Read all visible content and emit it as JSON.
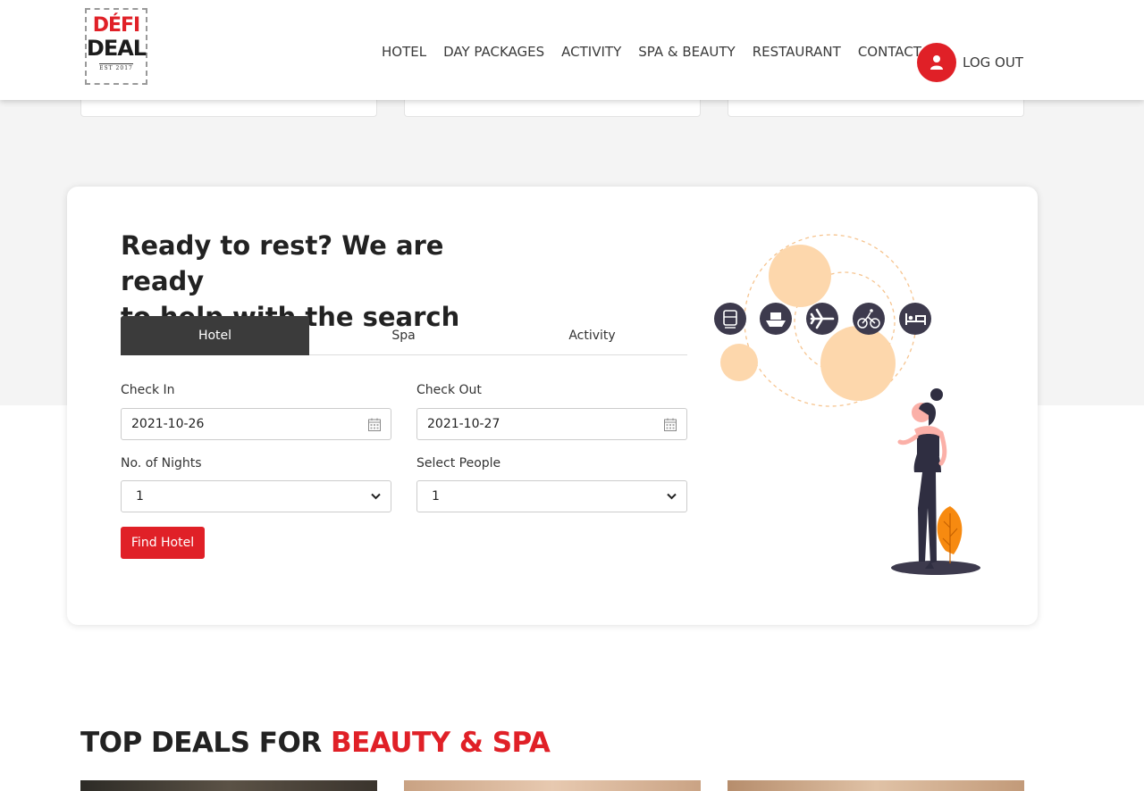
{
  "brand": {
    "logo_line1": "DÉFI",
    "logo_line2": "DEAL",
    "logo_est": "EST 2017"
  },
  "nav": {
    "items": [
      "HOTEL",
      "DAY PACKAGES",
      "ACTIVITY",
      "SPA & BEAUTY",
      "RESTAURANT",
      "CONTACT"
    ],
    "logout_label": "LOG OUT",
    "user_icon": "user-icon"
  },
  "search": {
    "title_line1": "Ready to rest? We are ready",
    "title_line2": "to help with the search",
    "tabs": [
      {
        "label": "Hotel",
        "active": true
      },
      {
        "label": "Spa",
        "active": false
      },
      {
        "label": "Activity",
        "active": false
      }
    ],
    "check_in": {
      "label": "Check In",
      "value": "2021-10-26",
      "icon": "calendar-icon"
    },
    "check_out": {
      "label": "Check Out",
      "value": "2021-10-27",
      "icon": "calendar-icon"
    },
    "nights": {
      "label": "No. of Nights",
      "value": "1",
      "icon": "chevron-down-icon"
    },
    "people": {
      "label": "Select People",
      "value": "1",
      "icon": "chevron-down-icon"
    },
    "submit_label": "Find Hotel"
  },
  "illustration": {
    "icons": [
      "train-icon",
      "ship-icon",
      "plane-icon",
      "bicycle-icon",
      "bed-icon"
    ]
  },
  "section": {
    "title_part1": "TOP DEALS FOR ",
    "title_part2": "BEAUTY & SPA"
  },
  "colors": {
    "accent": "#e02027",
    "dark": "#3b3b3b",
    "peach": "#fdd7ac",
    "orange": "#f78a10"
  }
}
